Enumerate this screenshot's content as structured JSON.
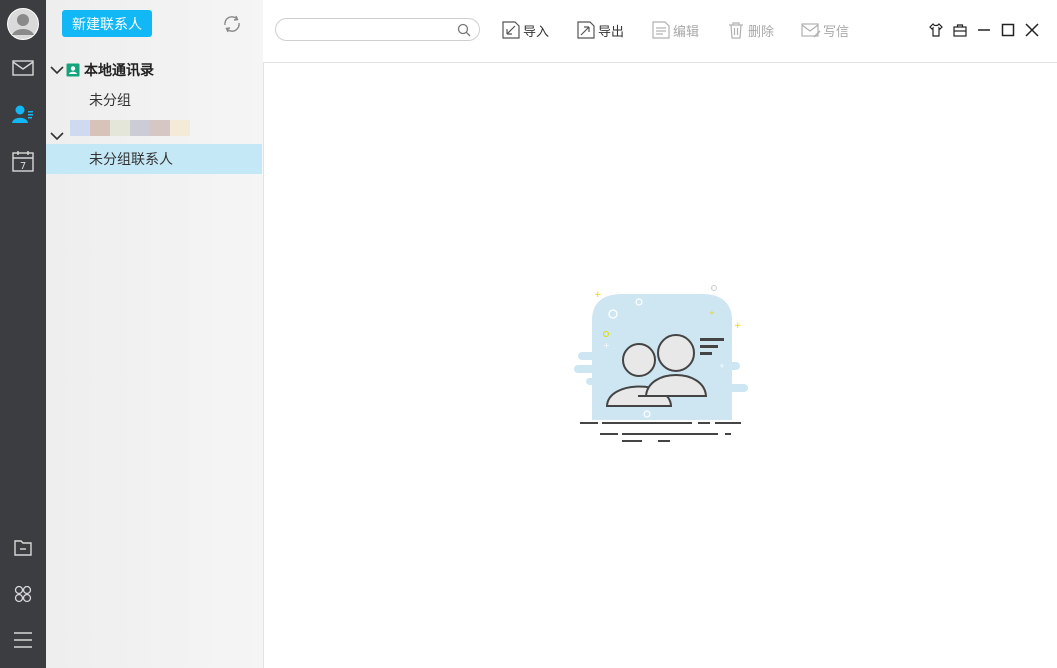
{
  "rail": {
    "items": [
      "avatar-icon",
      "mail-icon",
      "contacts-icon",
      "calendar-icon",
      "folder-icon",
      "apps-icon",
      "menu-icon"
    ],
    "calendar_day": "7",
    "active_color": "#12b7f5"
  },
  "sidebar": {
    "new_contact_label": "新建联系人",
    "groups": [
      {
        "label": "本地通讯录",
        "children": [
          {
            "label": "未分组"
          }
        ]
      },
      {
        "label": "",
        "children": [
          {
            "label": "未分组联系人",
            "selected": true
          }
        ]
      }
    ]
  },
  "toolbar": {
    "search_placeholder": "",
    "buttons": [
      {
        "label": "导入",
        "icon": "import-icon",
        "enabled": true
      },
      {
        "label": "导出",
        "icon": "export-icon",
        "enabled": true
      },
      {
        "label": "编辑",
        "icon": "edit-icon",
        "enabled": false
      },
      {
        "label": "删除",
        "icon": "trash-icon",
        "enabled": false
      },
      {
        "label": "写信",
        "icon": "write-mail-icon",
        "enabled": false
      }
    ],
    "window_controls": [
      "skin-icon",
      "bag-icon",
      "minimize-icon",
      "maximize-icon",
      "close-icon"
    ]
  },
  "colors": {
    "accent": "#12b7f5",
    "rail_bg": "#3b3d41",
    "selected_bg": "#c5e8f7",
    "illustration_bg": "#cde6f2"
  }
}
